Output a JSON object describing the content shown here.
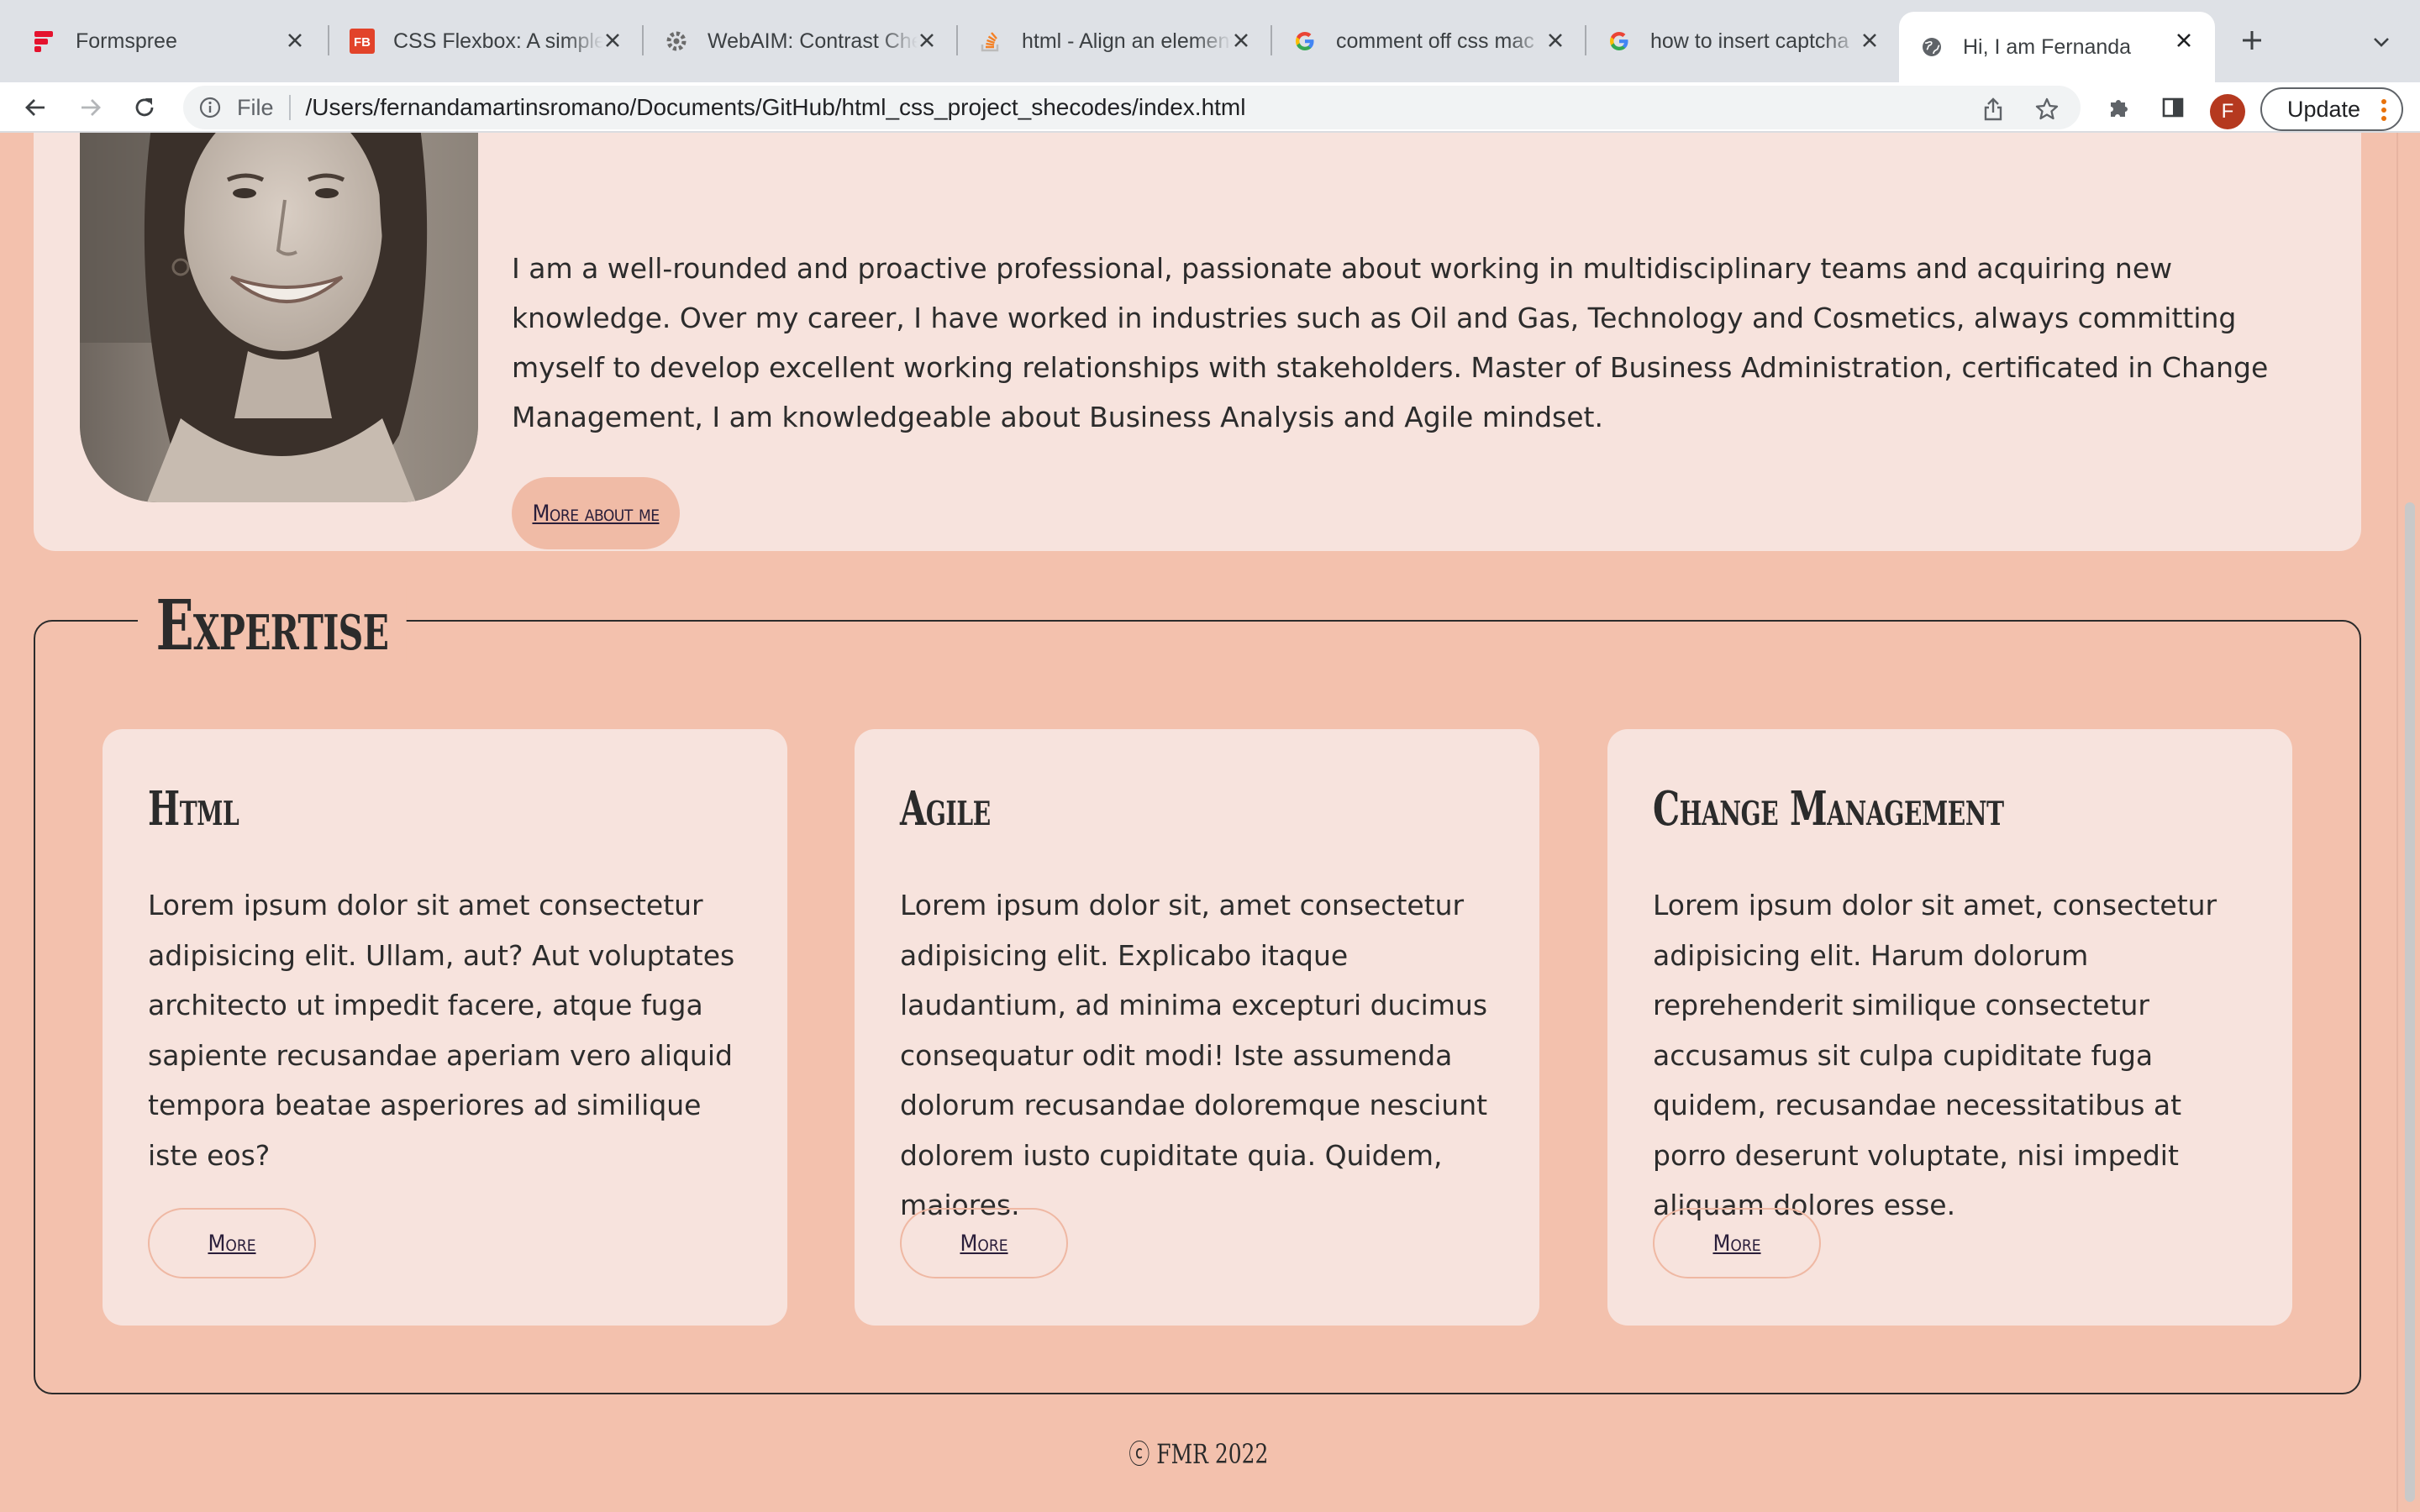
{
  "browser": {
    "tabs": [
      {
        "title": "Formspree",
        "icon": "formspree-icon",
        "active": false
      },
      {
        "title": "CSS Flexbox: A simple guide",
        "icon": "fb-icon",
        "active": false
      },
      {
        "title": "WebAIM: Contrast Checker",
        "icon": "webaim-icon",
        "active": false
      },
      {
        "title": "html - Align an element",
        "icon": "stackoverflow-icon",
        "active": false
      },
      {
        "title": "comment off css mac",
        "icon": "google-icon",
        "active": false
      },
      {
        "title": "how to insert captcha",
        "icon": "google-icon",
        "active": false
      },
      {
        "title": "Hi, I am Fernanda",
        "icon": "globe-icon",
        "active": true
      }
    ],
    "address": {
      "scheme_label": "File",
      "url": "/Users/fernandamartinsromano/Documents/GitHub/html_css_project_shecodes/index.html"
    },
    "profile_initial": "F",
    "update_label": "Update"
  },
  "about": {
    "text": "I am a well-rounded and proactive professional, passionate about working in multidisciplinary teams and acquiring new knowledge. Over my career, I have worked in industries such as Oil and Gas, Technology and Cosmetics, always committing myself to develop excellent working relationships with stakeholders. Master of Business Administration, certificated in Change Management, I am knowledgeable about Business Analysis and Agile mindset.",
    "button_label": "More about me"
  },
  "expertise": {
    "title": "Expertise",
    "cards": [
      {
        "title": "Html",
        "body": "Lorem ipsum dolor sit amet consectetur adipisicing elit. Ullam, aut? Aut voluptates architecto ut impedit facere, atque fuga sapiente recusandae aperiam vero aliquid tempora beatae asperiores ad similique iste eos?",
        "button_label": "More"
      },
      {
        "title": "Agile",
        "body": "Lorem ipsum dolor sit, amet consectetur adipisicing elit. Explicabo itaque laudantium, ad minima excepturi ducimus consequatur odit modi! Iste assumenda dolorum recusandae doloremque nesciunt dolorem iusto cupiditate quia. Quidem, maiores.",
        "button_label": "More"
      },
      {
        "title": "Change Management",
        "body": "Lorem ipsum dolor sit amet, consectetur adipisicing elit. Harum dolorum reprehenderit similique consectetur accusamus sit culpa cupiditate fuga quidem, recusandae necessitatibus at porro deserunt voluptate, nisi impedit aliquam dolores esse.",
        "button_label": "More"
      }
    ]
  },
  "footer": {
    "text": "ⓒ FMR 2022"
  },
  "colors": {
    "page_background": "#f3c1ad",
    "card_background": "#f7e3dd",
    "button_fill": "#f0bba6",
    "text": "#2c2c2c",
    "link": "#2a1e3a"
  }
}
